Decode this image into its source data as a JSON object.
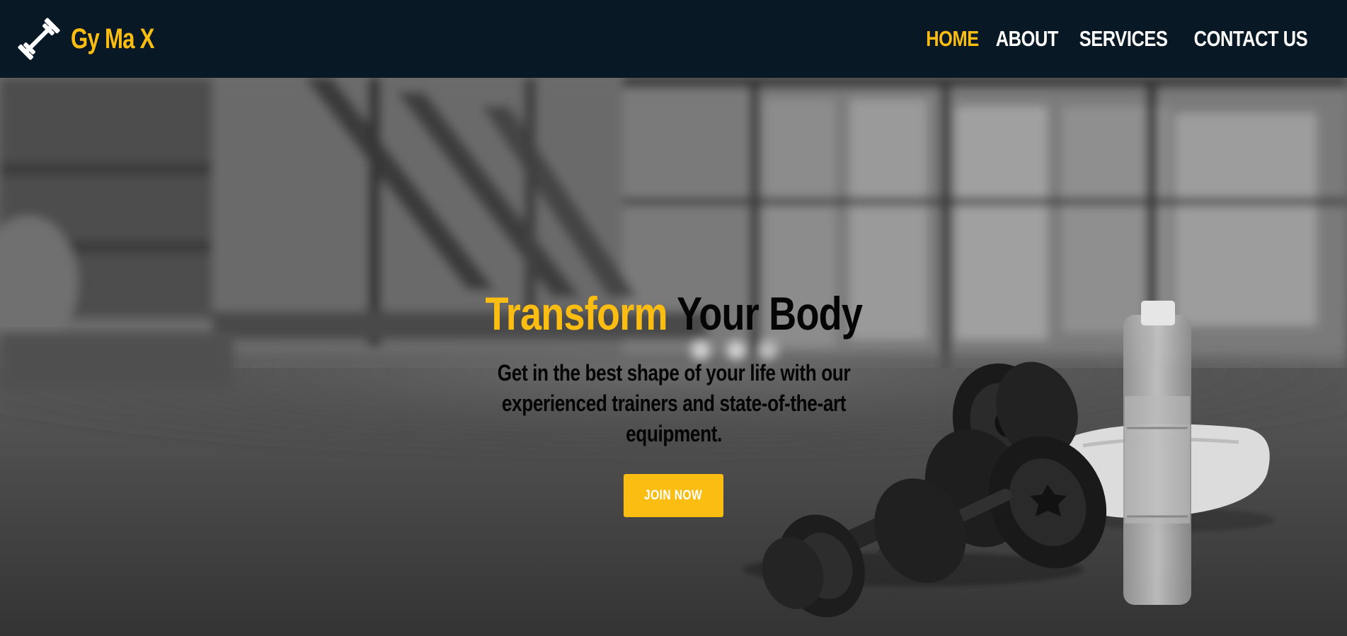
{
  "brand": {
    "name": "Gy Ma X",
    "accent_color": "#fbbd12",
    "icon": "dumbbell-icon"
  },
  "nav": {
    "items": [
      {
        "label": "HOME",
        "active": true
      },
      {
        "label": "ABOUT",
        "active": false
      },
      {
        "label": "SERVICES",
        "active": false
      },
      {
        "label": "CONTACT US",
        "active": false
      }
    ],
    "background_color": "#081925"
  },
  "hero": {
    "title_accent": "Transform",
    "title_rest": " Your Body",
    "subtitle": "Get in the best shape of your life with our experienced trainers and state-of-the-art equipment.",
    "cta_label": "JOIN NOW"
  }
}
